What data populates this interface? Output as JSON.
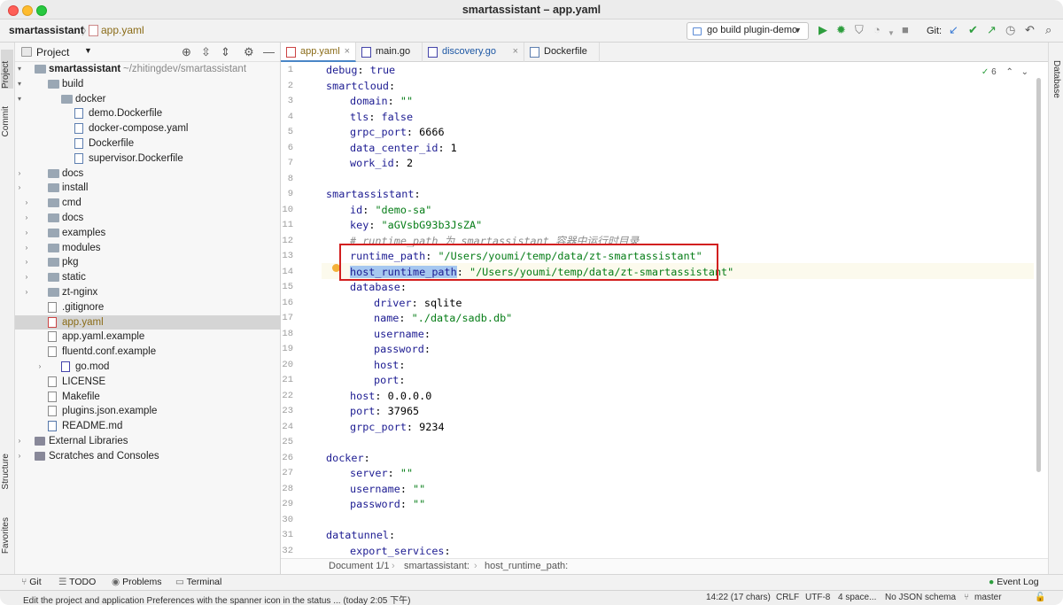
{
  "window": {
    "title": "smartassistant – app.yaml"
  },
  "navbar": {
    "project": "smartassistant",
    "file": "app.yaml",
    "run_config": "go build plugin-demo",
    "git_label": "Git:"
  },
  "left_stripe": {
    "project": "Project",
    "commit": "Commit",
    "structure": "Structure",
    "favorites": "Favorites"
  },
  "right_stripe": {
    "database": "Database"
  },
  "project_panel": {
    "title": "Project",
    "tree": [
      {
        "label": "smartassistant",
        "hint": "~/zhitingdev/smartassistant"
      },
      {
        "label": "build"
      },
      {
        "label": "docker"
      },
      {
        "label": "demo.Dockerfile"
      },
      {
        "label": "docker-compose.yaml"
      },
      {
        "label": "Dockerfile"
      },
      {
        "label": "supervisor.Dockerfile"
      },
      {
        "label": "docs"
      },
      {
        "label": "install"
      },
      {
        "label": "cmd"
      },
      {
        "label": "docs"
      },
      {
        "label": "examples"
      },
      {
        "label": "modules"
      },
      {
        "label": "pkg"
      },
      {
        "label": "static"
      },
      {
        "label": "zt-nginx"
      },
      {
        "label": ".gitignore"
      },
      {
        "label": "app.yaml"
      },
      {
        "label": "app.yaml.example"
      },
      {
        "label": "fluentd.conf.example"
      },
      {
        "label": "go.mod"
      },
      {
        "label": "LICENSE"
      },
      {
        "label": "Makefile"
      },
      {
        "label": "plugins.json.example"
      },
      {
        "label": "README.md"
      },
      {
        "label": "External Libraries"
      },
      {
        "label": "Scratches and Consoles"
      }
    ]
  },
  "tabs": [
    {
      "label": "app.yaml",
      "active": true
    },
    {
      "label": "main.go"
    },
    {
      "label": "discovery.go"
    },
    {
      "label": "Dockerfile"
    }
  ],
  "editor": {
    "inspection_count": "6",
    "lines": [
      {
        "n": "1",
        "key": "debug",
        "val": "true",
        "vt": "k",
        "indent": 0
      },
      {
        "n": "2",
        "key": "smartcloud",
        "val": "",
        "indent": 0
      },
      {
        "n": "3",
        "key": "domain",
        "val": "\"\"",
        "vt": "s",
        "indent": 1
      },
      {
        "n": "4",
        "key": "tls",
        "val": "false",
        "vt": "k",
        "indent": 1
      },
      {
        "n": "5",
        "key": "grpc_port",
        "val": "6666",
        "vt": "p",
        "indent": 1
      },
      {
        "n": "6",
        "key": "data_center_id",
        "val": "1",
        "vt": "p",
        "indent": 1
      },
      {
        "n": "7",
        "key": "work_id",
        "val": "2",
        "vt": "p",
        "indent": 1
      },
      {
        "n": "8",
        "key": "",
        "val": "",
        "indent": 0
      },
      {
        "n": "9",
        "key": "smartassistant",
        "val": "",
        "indent": 0
      },
      {
        "n": "10",
        "key": "id",
        "val": "\"demo-sa\"",
        "vt": "s",
        "indent": 1
      },
      {
        "n": "11",
        "key": "key",
        "val": "\"aGVsbG93b3JsZA\"",
        "vt": "s",
        "indent": 1
      },
      {
        "n": "12",
        "comment": "# runtime_path 为 smartassistant 容器中运行时目录",
        "indent": 1
      },
      {
        "n": "13",
        "key": "runtime_path",
        "val": "\"/Users/youmi/temp/data/zt-smartassistant\"",
        "vt": "s",
        "indent": 1
      },
      {
        "n": "14",
        "key": "host_runtime_path",
        "val": "\"/Users/youmi/temp/data/zt-smartassistant\"",
        "vt": "s",
        "indent": 1,
        "selected": true
      },
      {
        "n": "15",
        "key": "database",
        "val": "",
        "indent": 1
      },
      {
        "n": "16",
        "key": "driver",
        "val": "sqlite",
        "vt": "p",
        "indent": 2
      },
      {
        "n": "17",
        "key": "name",
        "val": "\"./data/sadb.db\"",
        "vt": "s",
        "indent": 2
      },
      {
        "n": "18",
        "key": "username",
        "val": "",
        "indent": 2
      },
      {
        "n": "19",
        "key": "password",
        "val": "",
        "indent": 2
      },
      {
        "n": "20",
        "key": "host",
        "val": "",
        "indent": 2
      },
      {
        "n": "21",
        "key": "port",
        "val": "",
        "indent": 2
      },
      {
        "n": "22",
        "key": "host",
        "val": "0.0.0.0",
        "vt": "p",
        "indent": 1
      },
      {
        "n": "23",
        "key": "port",
        "val": "37965",
        "vt": "p",
        "indent": 1
      },
      {
        "n": "24",
        "key": "grpc_port",
        "val": "9234",
        "vt": "p",
        "indent": 1
      },
      {
        "n": "25",
        "key": "",
        "val": "",
        "indent": 0
      },
      {
        "n": "26",
        "key": "docker",
        "val": "",
        "indent": 0
      },
      {
        "n": "27",
        "key": "server",
        "val": "\"\"",
        "vt": "s",
        "indent": 1
      },
      {
        "n": "28",
        "key": "username",
        "val": "\"\"",
        "vt": "s",
        "indent": 1
      },
      {
        "n": "29",
        "key": "password",
        "val": "\"\"",
        "vt": "s",
        "indent": 1
      },
      {
        "n": "30",
        "key": "",
        "val": "",
        "indent": 0
      },
      {
        "n": "31",
        "key": "datatunnel",
        "val": "",
        "indent": 0
      },
      {
        "n": "32",
        "key": "export_services",
        "val": "",
        "indent": 1
      }
    ],
    "breadcrumb": [
      "Document 1/1",
      "smartassistant:",
      "host_runtime_path:"
    ]
  },
  "bottom_tools": {
    "git": "Git",
    "todo": "TODO",
    "problems": "Problems",
    "terminal": "Terminal",
    "event_log": "Event Log"
  },
  "status": {
    "message": "Edit the project and application Preferences with the spanner icon in the status ... (today 2:05 下午)",
    "position": "14:22 (17 chars)",
    "line_sep": "CRLF",
    "encoding": "UTF-8",
    "indent": "4 space...",
    "schema": "No JSON schema",
    "branch": "master"
  }
}
